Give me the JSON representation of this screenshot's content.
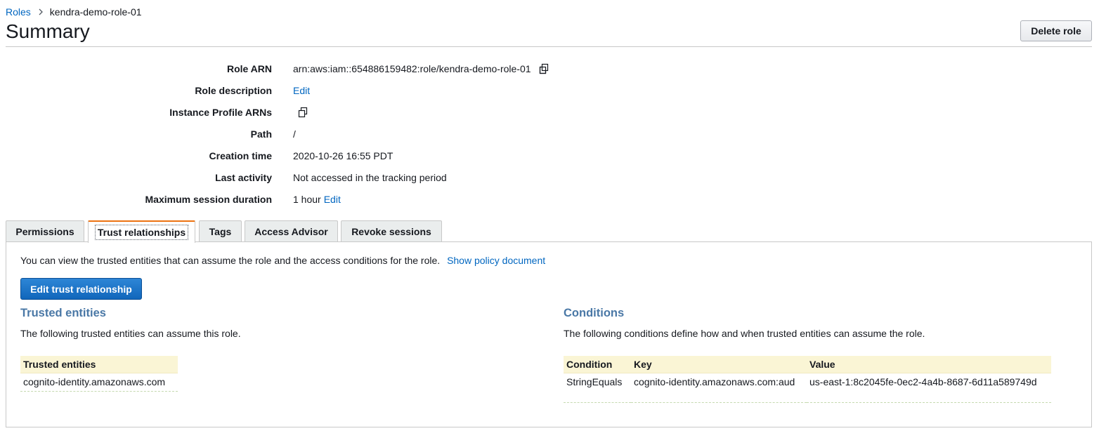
{
  "breadcrumb": {
    "root": "Roles",
    "separator": ">",
    "current": "kendra-demo-role-01"
  },
  "header": {
    "title": "Summary",
    "delete_button": "Delete role"
  },
  "summary": {
    "role_arn": {
      "label": "Role ARN",
      "value": "arn:aws:iam::654886159482:role/kendra-demo-role-01",
      "icon": "copy-icon"
    },
    "role_description": {
      "label": "Role description",
      "link": "Edit"
    },
    "instance_profile": {
      "label": "Instance Profile ARNs",
      "icon": "copy-icon"
    },
    "path": {
      "label": "Path",
      "value": "/"
    },
    "creation_time": {
      "label": "Creation time",
      "value": "2020-10-26 16:55 PDT"
    },
    "last_activity": {
      "label": "Last activity",
      "value": "Not accessed in the tracking period"
    },
    "max_session": {
      "label": "Maximum session duration",
      "value": "1 hour",
      "link": "Edit"
    }
  },
  "tabs": [
    {
      "label": "Permissions",
      "active": false
    },
    {
      "label": "Trust relationships",
      "active": true
    },
    {
      "label": "Tags",
      "active": false
    },
    {
      "label": "Access Advisor",
      "active": false
    },
    {
      "label": "Revoke sessions",
      "active": false
    }
  ],
  "trust": {
    "intro": "You can view the trusted entities that can assume the role and the access conditions for the role.",
    "show_policy": "Show policy document",
    "edit_button": "Edit trust relationship",
    "trusted_entities": {
      "title": "Trusted entities",
      "description": "The following trusted entities can assume this role.",
      "column": "Trusted entities",
      "rows": [
        "cognito-identity.amazonaws.com"
      ]
    },
    "conditions": {
      "title": "Conditions",
      "description": "The following conditions define how and when trusted entities can assume the role.",
      "columns": [
        "Condition",
        "Key",
        "Value"
      ],
      "rows": [
        [
          "StringEquals",
          "cognito-identity.amazonaws.com:aud",
          "us-east-1:8c2045fe-0ec2-4a4b-8687-6d11a589749d"
        ]
      ]
    }
  },
  "colors": {
    "link": "#0066c0",
    "primary": "#1166bb",
    "tab_accent": "#ec7211",
    "section_title": "#4a78a6",
    "table_header": "#faf5d5"
  }
}
